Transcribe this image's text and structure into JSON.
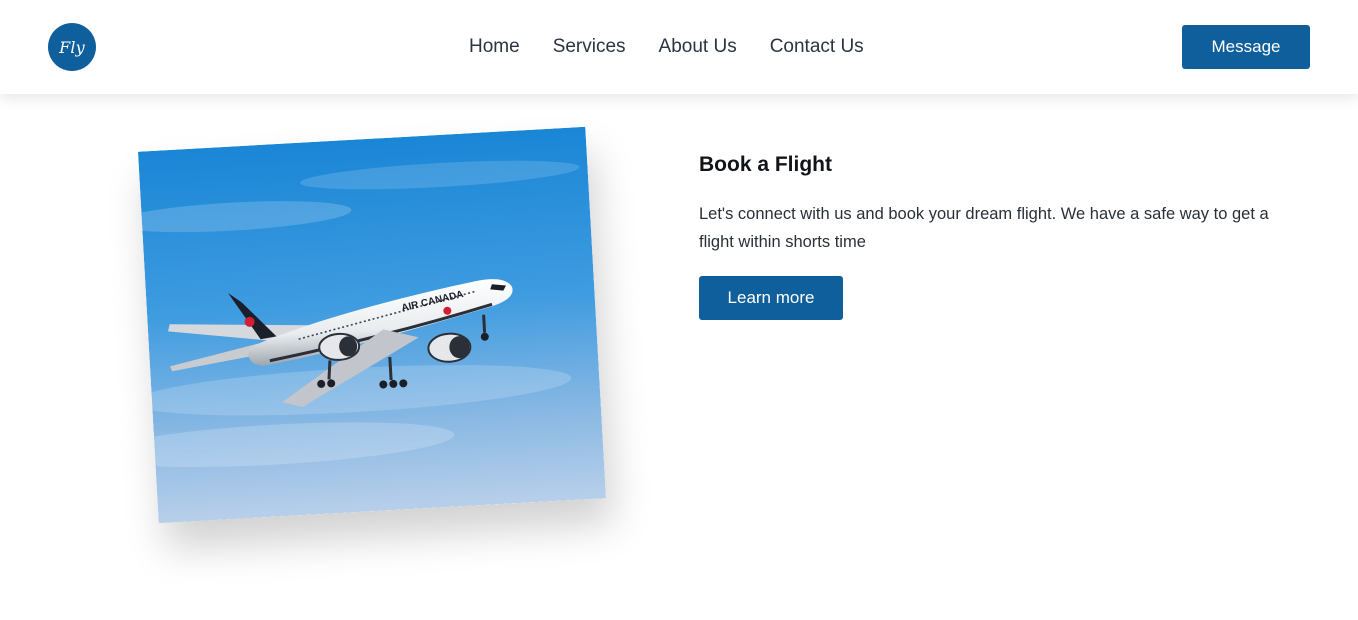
{
  "header": {
    "logo_text": "Fly",
    "nav": [
      {
        "label": "Home"
      },
      {
        "label": "Services"
      },
      {
        "label": "About Us"
      },
      {
        "label": "Contact Us"
      }
    ],
    "message_button": "Message"
  },
  "hero": {
    "image_alt_icon": "airplane-photo",
    "airline_livery_text": "AIR CANADA",
    "title": "Book a Flight",
    "description": "Let's connect with us and book your dream flight. We have a safe way to get a flight within shorts time",
    "cta_label": "Learn more"
  },
  "colors": {
    "brand": "#0f5f9c",
    "background": "#ffffff",
    "heading": "#111418",
    "body_text": "#2a3038"
  }
}
